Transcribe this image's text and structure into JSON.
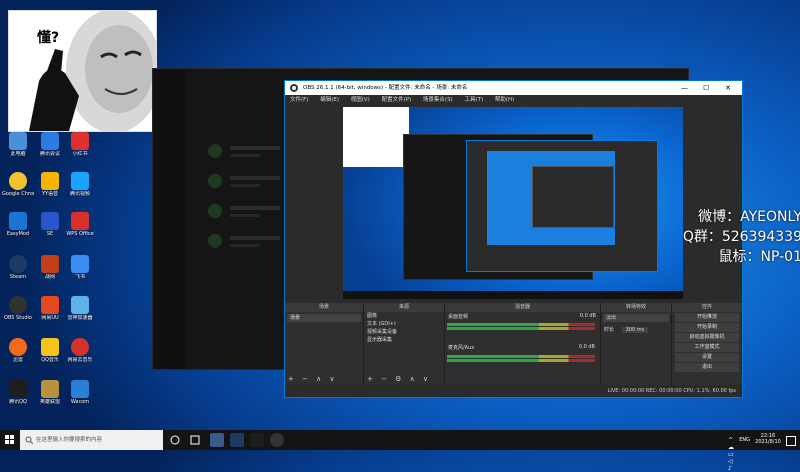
{
  "desktop": {
    "meme_text": "懂?",
    "icons": [
      {
        "label": "此电脑",
        "color": "#4a8fd8"
      },
      {
        "label": "腾讯会议",
        "color": "#2d7be0"
      },
      {
        "label": "小红书",
        "color": "#e03131"
      },
      {
        "label": "Google Chrome",
        "color": "#f2c12e"
      },
      {
        "label": "YY语音",
        "color": "#f5b400"
      },
      {
        "label": "腾讯视频",
        "color": "#1aa3ff"
      },
      {
        "label": "EasyMod",
        "color": "#1b73d6"
      },
      {
        "label": "SE",
        "color": "#2955c8"
      },
      {
        "label": "WPS Office",
        "color": "#d9302c"
      },
      {
        "label": "Steam",
        "color": "#1d3a63"
      },
      {
        "label": "战网",
        "color": "#c23f1c"
      },
      {
        "label": "飞书",
        "color": "#3c8ef5"
      },
      {
        "label": "OBS Studio",
        "color": "#323232"
      },
      {
        "label": "网易UU",
        "color": "#e44b1f"
      },
      {
        "label": "雷神加速器",
        "color": "#5bb3e8"
      },
      {
        "label": "迅雷",
        "color": "#f26a1b"
      },
      {
        "label": "QQ音乐",
        "color": "#f6c31a"
      },
      {
        "label": "网易云音乐",
        "color": "#d6322d"
      },
      {
        "label": "腾讯QQ",
        "color": "#1e1e1e"
      },
      {
        "label": "英雄联盟",
        "color": "#b9923c"
      },
      {
        "label": "Wacom",
        "color": "#2a7fd6"
      }
    ]
  },
  "obs": {
    "title": "OBS 26.1.1 (64-bit, windows) - 配置文件: 未命名 - 场景: 未命名",
    "menu": [
      "文件(F)",
      "编辑(E)",
      "视图(V)",
      "配置文件(P)",
      "场景集合(S)",
      "工具(T)",
      "帮助(H)"
    ],
    "window_buttons": [
      "—",
      "☐",
      "✕"
    ],
    "docks": {
      "scenes_header": "场景",
      "scenes": [
        "场景"
      ],
      "sources_header": "来源",
      "sources": [
        "图像",
        "文本 (GDI+)",
        "视频采集设备",
        "显示器采集"
      ],
      "mixer_header": "混音器",
      "mixer_channels": [
        {
          "name": "桌面音频",
          "db": "0.0 dB"
        },
        {
          "name": "麦克风/Aux",
          "db": "0.0 dB"
        }
      ],
      "transitions_header": "转场特效",
      "transition_type": "淡出",
      "duration_label": "时长",
      "duration_value": "300 ms",
      "controls_header": "控件",
      "controls": [
        "开始推流",
        "开始录制",
        "启动虚拟摄像机",
        "工作室模式",
        "设置",
        "退出"
      ]
    },
    "status": "LIVE: 00:00:00   REC: 00:00:00   CPU: 1.1%, 60.00 fps"
  },
  "overlay": {
    "weibo": "微博：AYEONLY",
    "qq_group": "Q群：526394339",
    "mouse": "鼠标：NP-01"
  },
  "taskbar": {
    "search_placeholder": "在这里输入你要搜索的内容",
    "lang": "ENG",
    "time": "22:16",
    "date": "2021/8/10"
  }
}
